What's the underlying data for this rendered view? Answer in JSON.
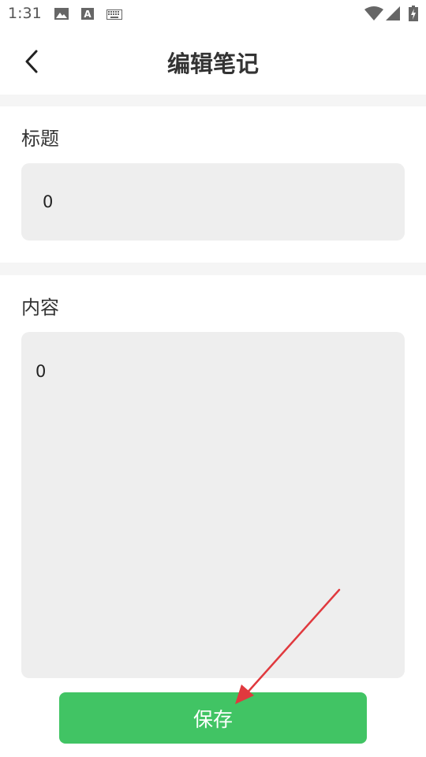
{
  "status_bar": {
    "time": "1:31",
    "icons": [
      "image-icon",
      "font-a-icon",
      "keyboard-icon",
      "wifi-icon",
      "signal-icon",
      "battery-charging-icon"
    ]
  },
  "header": {
    "title": "编辑笔记",
    "back_icon": "chevron-left-icon"
  },
  "form": {
    "title_label": "标题",
    "title_value": "0",
    "content_label": "内容",
    "content_value": "0"
  },
  "save_button": {
    "label": "保存"
  },
  "colors": {
    "accent_green": "#41c464",
    "input_bg": "#eeeeee",
    "separator": "#f5f5f5",
    "annotation_red": "#e0393e"
  }
}
